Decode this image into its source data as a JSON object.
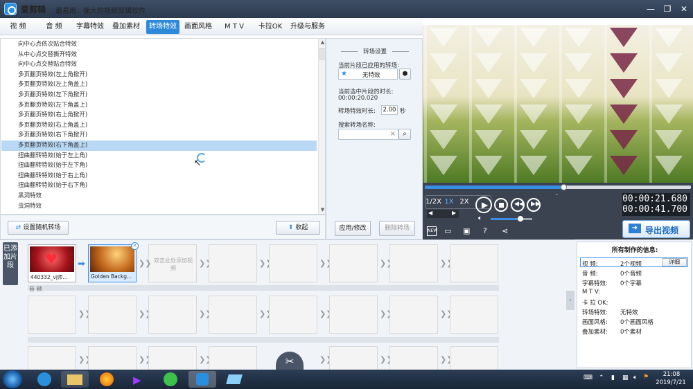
{
  "window": {
    "title": "爱剪辑",
    "slogan": "最易用、强大的视频剪辑软件"
  },
  "tabs": [
    {
      "label": "视 频"
    },
    {
      "label": "音 频"
    },
    {
      "label": "字幕特效"
    },
    {
      "label": "叠加素材"
    },
    {
      "label": "转场特效"
    },
    {
      "label": "画面风格"
    },
    {
      "label": "M T V"
    },
    {
      "label": "卡拉OK"
    },
    {
      "label": "升级与服务"
    }
  ],
  "effects_list": [
    "向中心点依次贴合特效",
    "从中心点交替撕开特效",
    "向中心点交替贴合特效",
    "多页翻页特效(左上角掀开)",
    "多页翻页特效(左上角盖上)",
    "多页翻页特效(左下角掀开)",
    "多页翻页特效(左下角盖上)",
    "多页翻页特效(右上角掀开)",
    "多页翻页特效(右上角盖上)",
    "多页翻页特效(右下角掀开)",
    "多页翻页特效(右下角盖上)",
    "扭曲翻转特效(始于左上角)",
    "扭曲翻转特效(始于左下角)",
    "扭曲翻转特效(始于右上角)",
    "扭曲翻转特效(始于右下角)",
    "黑洞特效",
    "虫洞特效"
  ],
  "selected_effect_index": 10,
  "settings": {
    "heading": "转场设置",
    "applied_label": "当前片段已应用的转场:",
    "applied_value": "无特效",
    "duration_label": "当前选中片段的时长:",
    "duration_value": "00:00:20.020",
    "effect_duration_label": "转场特效时长:",
    "effect_duration_value": "2.00",
    "seconds_unit": "秒",
    "search_label": "搜索转场名称:",
    "search_value": "",
    "apply_button": "应用/修改",
    "delete_button": "删除转场"
  },
  "bottom": {
    "random_button": "设置随机转场",
    "collapse_button": "收起"
  },
  "player": {
    "speed_half": "1/2X",
    "speed_1x": "1X",
    "speed_2x": "2X",
    "current_time": "00:00:21.680",
    "total_time": "00:00:41.700",
    "progress": 0.52,
    "volume": 0.72,
    "export_button": "导出视频"
  },
  "timeline": {
    "side_label": "已添加片段",
    "clip1_caption": "440332_vj师...",
    "clip2_caption": "Golden Backg...",
    "add_hint": "双击此处添加视频",
    "audio_label": "音 频"
  },
  "info": {
    "title": "所有制作的信息:",
    "rows": [
      {
        "k": "视    频:",
        "v": "2个视频"
      },
      {
        "k": "音    频:",
        "v": "0个音频"
      },
      {
        "k": "字幕特效:",
        "v": "0个字幕"
      },
      {
        "k": "M  T  V:",
        "v": ""
      },
      {
        "k": "卡 拉 OK:",
        "v": ""
      },
      {
        "k": "转场特效:",
        "v": "无特效"
      },
      {
        "k": "画面风格:",
        "v": "0个画面风格"
      },
      {
        "k": "叠加素材:",
        "v": "0个素材"
      }
    ],
    "detail_button": "详细"
  },
  "taskbar": {
    "clock_time": "21:08",
    "clock_date": "2019/7/21"
  },
  "colors": {
    "accent": "#2e8ad8",
    "titlebar": "#2c3a4e",
    "selection": "#b9d8f5"
  }
}
